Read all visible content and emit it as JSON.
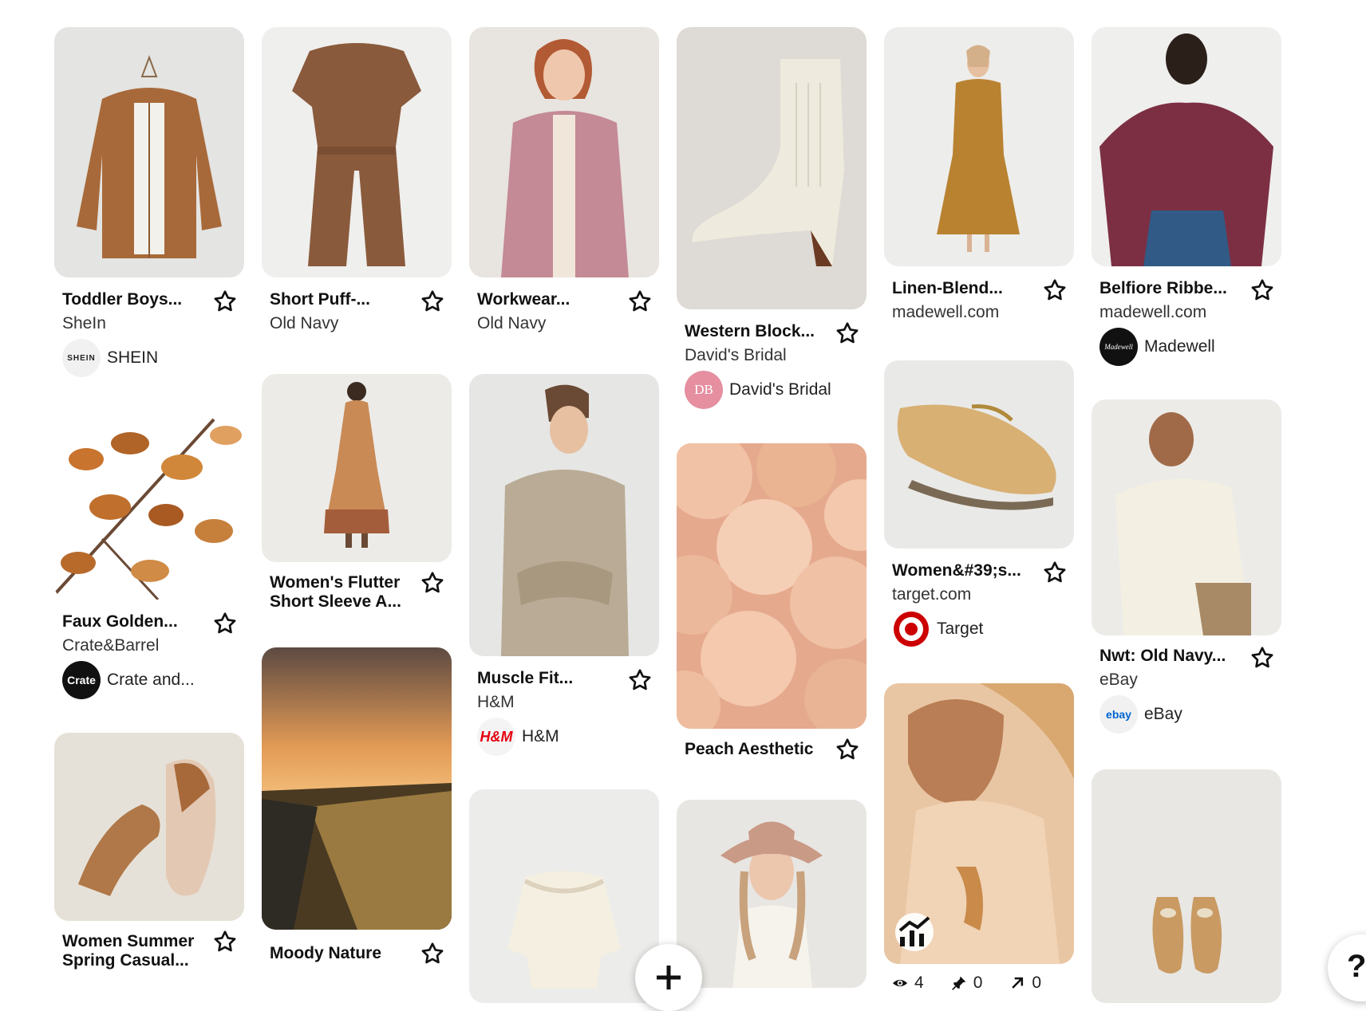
{
  "colors": {
    "background": "#ffffff",
    "text": "#111111",
    "muted": "#333333"
  },
  "pins": [
    {
      "title": "Toddler Boys...",
      "domain": "SheIn",
      "source": "SHEIN",
      "avatar_text": "SHEIN"
    },
    {
      "title": "Faux Golden...",
      "domain": "Crate&Barrel",
      "source": "Crate and...",
      "avatar_text": "Crate"
    },
    {
      "title": "Women Summer Spring Casual..."
    },
    {
      "title": "Short Puff-...",
      "domain": "Old Navy"
    },
    {
      "title": "Women's Flutter Short Sleeve A..."
    },
    {
      "title": "Moody Nature"
    },
    {
      "title": "Workwear...",
      "domain": "Old Navy"
    },
    {
      "title": "Muscle Fit...",
      "domain": "H&M",
      "source": "H&M",
      "avatar_text": "H&M"
    },
    {
      "title": "Western Block...",
      "domain": "David's Bridal",
      "source": "David's Bridal",
      "avatar_text": "DB"
    },
    {
      "title": "Peach Aesthetic"
    },
    {
      "title": "Linen-Blend...",
      "domain": "madewell.com"
    },
    {
      "title": "Women&#39;s...",
      "domain": "target.com",
      "source": "Target"
    },
    {
      "title": "Belfiore Ribbe...",
      "domain": "madewell.com",
      "source": "Madewell",
      "avatar_text": "Madewell"
    },
    {
      "title": "Nwt: Old Navy...",
      "domain": "eBay",
      "source": "eBay",
      "avatar_text": "ebay"
    }
  ],
  "stats": {
    "views": "4",
    "saves": "0",
    "outbound": "0"
  },
  "help_label": "?",
  "icons": {
    "star": "star-icon",
    "add": "plus-icon",
    "analytics": "analytics-icon",
    "eye": "eye-icon",
    "pin": "pin-icon",
    "outbound": "arrow-up-right-icon"
  }
}
